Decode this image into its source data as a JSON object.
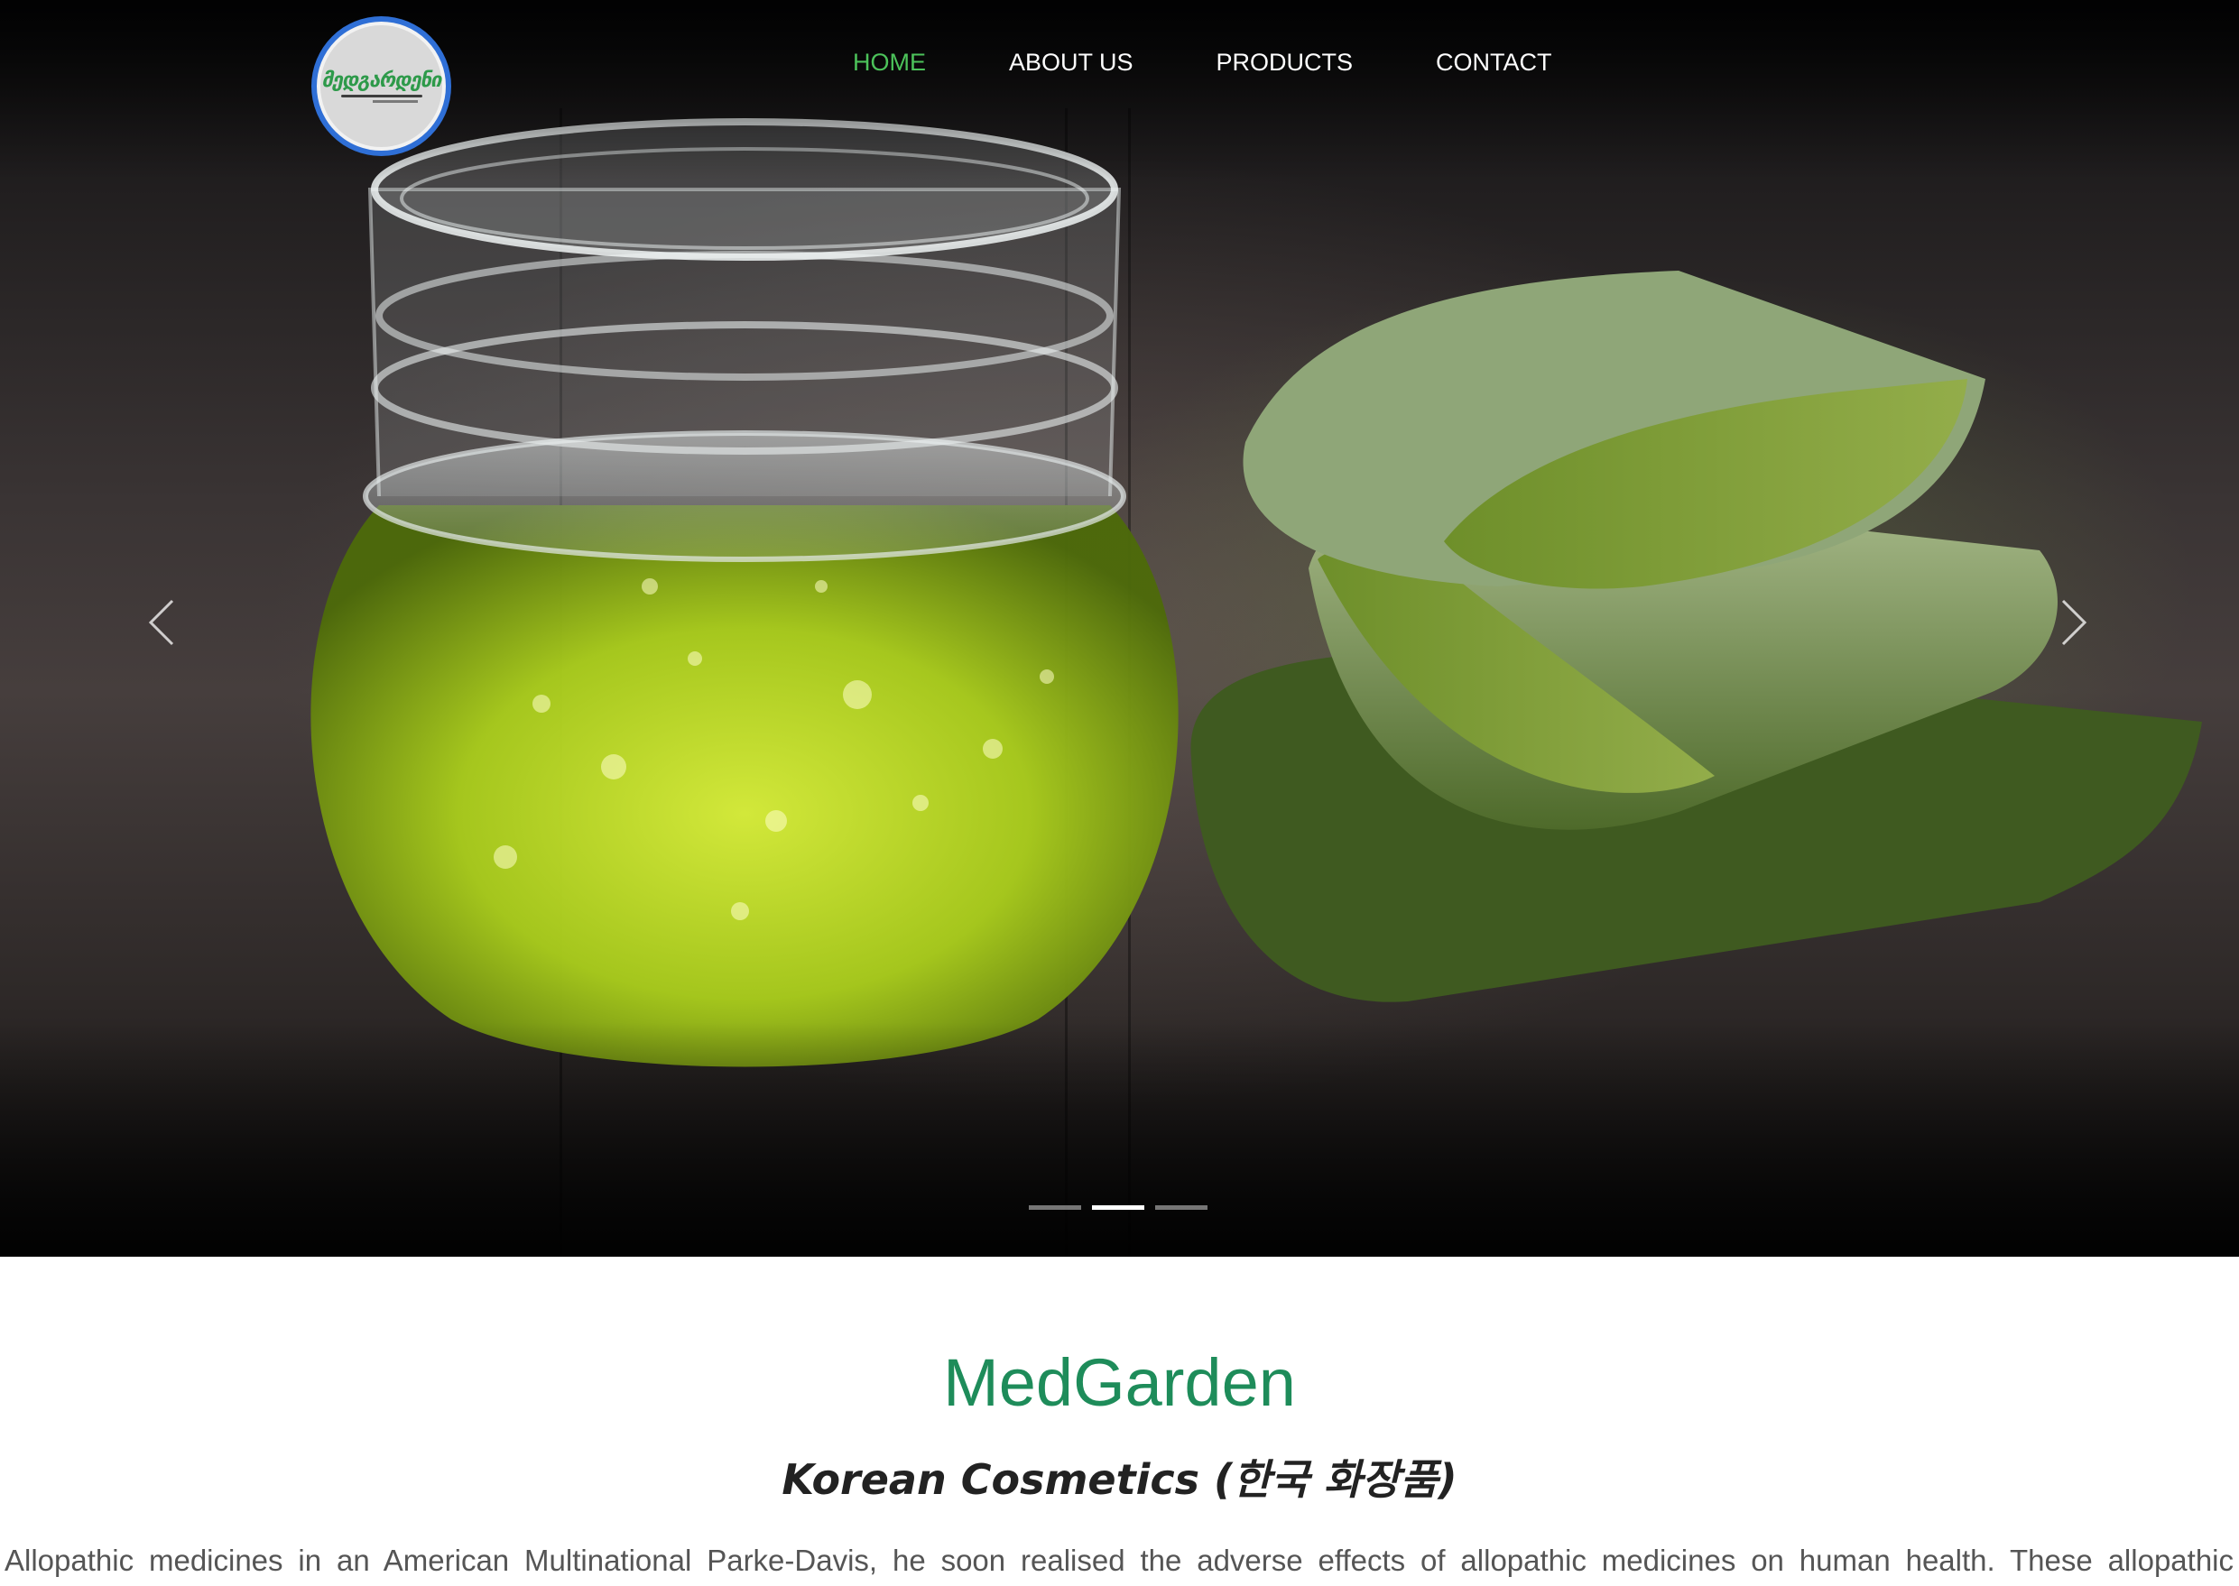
{
  "logo": {
    "text": "მედგარდენი",
    "icon": "logo-emblem"
  },
  "nav": {
    "items": [
      {
        "label": "HOME",
        "active": true
      },
      {
        "label": "ABOUT US",
        "active": false
      },
      {
        "label": "PRODUCTS",
        "active": false
      },
      {
        "label": "CONTACT",
        "active": false
      }
    ]
  },
  "carousel": {
    "prev_icon": "chevron-left-icon",
    "next_icon": "chevron-right-icon",
    "slide_count": 3,
    "active_slide": 2
  },
  "content": {
    "brand": "MedGarden",
    "tagline": "Korean Cosmetics (한국 화장품)",
    "intro": "Allopathic medicines in an American Multinational Parke-Davis, he soon realised the adverse effects of allopathic medicines on human health. These allopathic"
  },
  "colors": {
    "accent": "#4cc25a",
    "brand_green": "#1e8c5a",
    "logo_ring": "#2f6fd6"
  }
}
